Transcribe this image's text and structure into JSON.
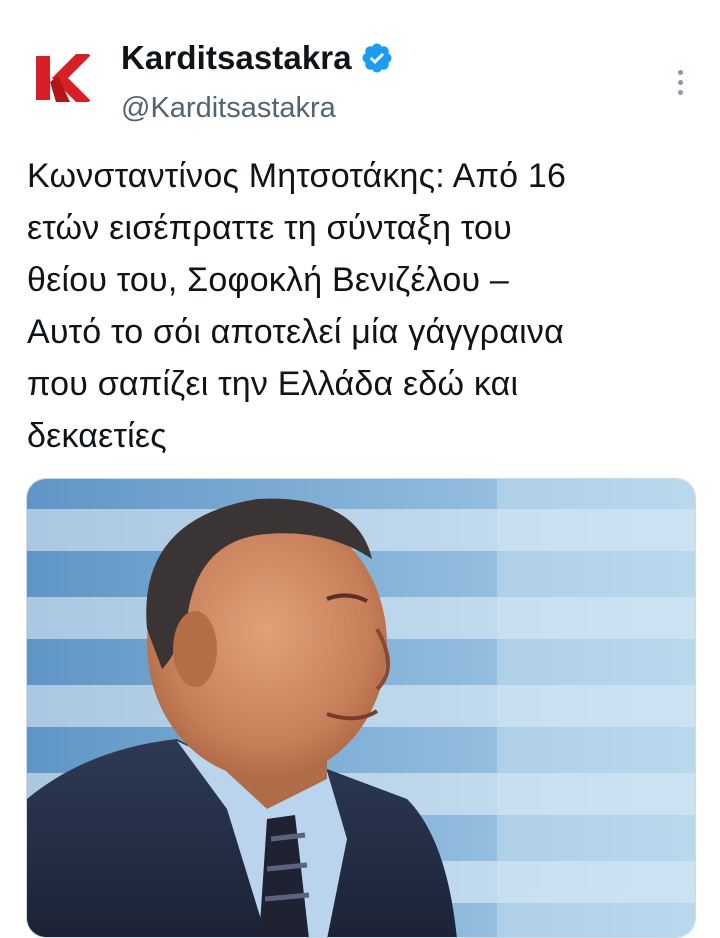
{
  "account": {
    "display_name": "Karditsastakra",
    "handle": "@Karditsastakra",
    "verified": true,
    "avatar_letter": "K",
    "avatar_color": "#d71f26"
  },
  "tweet": {
    "text": "Κωνσταντίνος Μητσοτάκης: Από 16\nετών εισέπραττε τη σύνταξη του\nθείου του, Σοφοκλή Βενιζέλου –\nΑυτό το σόι αποτελεί μία γάγγραινα\nπου σαπίζει την Ελλάδα εδώ και\nδεκαετίες"
  },
  "media": {
    "description_icon": "photo-of-man-in-suit-with-greek-flag-background"
  },
  "colors": {
    "verified_blue": "#1d9bf0",
    "text_primary": "#0f1419",
    "text_secondary": "#536471"
  },
  "icons": {
    "more": "more-vertical-icon",
    "verified": "verified-badge-icon"
  }
}
